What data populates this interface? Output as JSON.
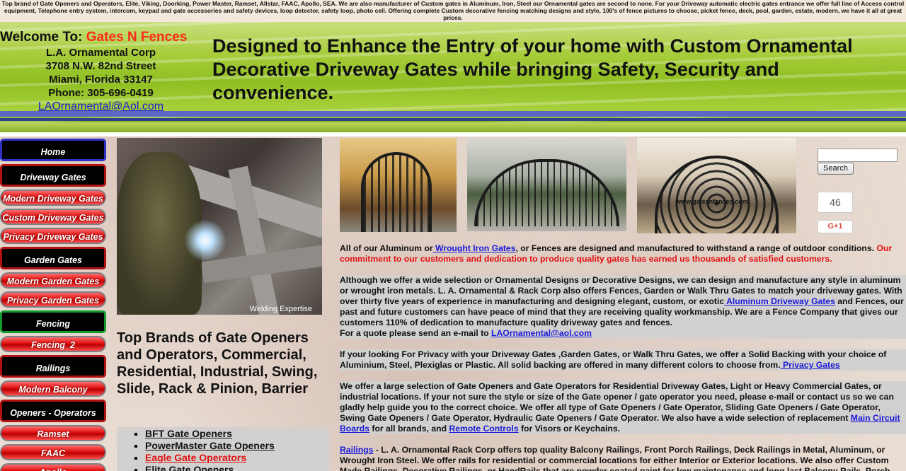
{
  "top_strip": {
    "text": "Top brand of Gate Openers and Operators, Elite, Viking, Doorking, Power Master, Ramset, Allstar, FAAC, Apollo, SEA. We are also manufacturer of Custom gates in Aluminum, Iron, Steel our Ornamental gates are second to none. For your Driveway automatic electric gates entrance we offer full line of Access control equipment, Telephone entry system, intercom, keypad and gate accessories and safety devices, loop detector, safety loop, photo cell. Offering complete Custom decorative fencing matching designs and style, 100's of fence pictures to choose, picket fence, deck, pool, garden, estate, modern, we have it all at great prices."
  },
  "header": {
    "welcome_prefix": "Welcome To: ",
    "welcome_brand": "Gates N Fences",
    "company": "L.A. Ornamental Corp",
    "street": "3708 N.W. 82nd Street",
    "city": "Miami, Florida 33147",
    "phone": "Phone: 305-696-0419",
    "email": "LAOrnamental@Aol.com",
    "tagline": "Designed to Enhance the Entry of your home with Custom Ornamental Decorative Driveway Gates while bringing Safety, Security and convenience."
  },
  "nav": {
    "items": [
      {
        "label": "Home"
      },
      {
        "label": "Driveway Gates"
      },
      {
        "label": "Modern Driveway Gates"
      },
      {
        "label": "Custom Driveway Gates"
      },
      {
        "label": "Privacy Driveway Gates"
      },
      {
        "label": "Garden Gates"
      },
      {
        "label": "Modern Garden Gates"
      },
      {
        "label": "Privacy Garden Gates"
      },
      {
        "label": "Fencing"
      },
      {
        "label": "Fencing_2"
      },
      {
        "label": "Railings"
      },
      {
        "label": "Modern Balcony Railings"
      },
      {
        "label": "Openers - Operators"
      },
      {
        "label": "Ramset"
      },
      {
        "label": "FAAC"
      },
      {
        "label": "Apollo"
      }
    ]
  },
  "welding_image": {
    "caption": "Welding Expertise"
  },
  "brands": {
    "title": "Top Brands of Gate Openers and Operators, Commercial, Residential, Industrial, Swing, Slide, Rack & Pinion, Barrier",
    "list": [
      "BFT Gate Openers",
      "PowerMaster Gate Openers",
      "Eagle Gate Operators",
      "Elite Gate Openers"
    ]
  },
  "gallery": {
    "watermark": "www.gatesnfences.com"
  },
  "sidebar_right": {
    "search_placeholder": "",
    "search_button": "Search",
    "share_count": "46",
    "gplus_label": "G+1"
  },
  "content": {
    "p1_a": "All of our Aluminum or",
    "p1_link": " Wrought Iron Gates",
    "p1_b": ", or Fences are designed and manufactured to withstand a range of outdoor conditions.",
    "p1_red": " Our commitment to our customers and dedication to produce quality gates has earned us thousands of satisfied customers.",
    "p2_a": "Although we offer a wide selection or Ornamental Designs or Decorative Designs, we can design and manufacture any style in aluminum or wrought iron metals. L. A. Ornamental & Rack Corp also offers Fences, Garden or Walk Thru Gates to match your driveway  gates. With over thirty five years of experience in manufacturing and designing elegant, custom, or exotic",
    "p2_link": " Aluminum Driveway Gates",
    "p2_b": " and Fences, our past and future customers can have peace of mind that they are receiving quality workmanship.  We are a Fence Company that gives our customers 110% of dedication to manufacture quality driveway gates and fences.",
    "p2_quote": "For a quote please send an e-mail to ",
    "p2_email": "LAOrnamental@aol.com",
    "p3_a": "If your looking For Privacy with your Driveway Gates ,Garden Gates, or Walk Thru Gates, we offer a Solid Backing with your choice of Aluminium, Steel, Plexiglas or Plastic.  All solid backing are offered in many different colors to choose from.",
    "p3_link": " Privacy Gates",
    "p4_a": "We offer a large selection of  Gate Openers and Gate Operators for Residential Driveway Gates, Light or Heavy Commercial Gates, or industrial locations. If your not sure the style or size of the Gate opener / gate operator  you need, please e-mail or contact us so we can gladly help guide you to the correct choice. We offer all type of Gate Openers / Gate Operator, Sliding Gate Openers / Gate Operator, Swing Gate Openers / Gate Operator, Hydraulic Gate Openers / Gate Operator. We also have a wide selection of replacement",
    "p4_link1": "Main Circuit Boards",
    "p4_b": " for all brands, and ",
    "p4_link2": "Remote Controls",
    "p4_c": "  for Visors or Keychains.",
    "p5_link": "Railings",
    "p5_a": " - L. A. Ornamental Rack Corp offers top quality Balcony Railings, Front Porch Railings, Deck Railings in Metal, Aluminum, or Wrought Iron Steel.  We offer rails for residential or commercial locations for either Interior or Exterior locations. We also offer Custom Made Railings, Decorative Railings, or HandRails that are powder coated paint for low maintenance and long last Balcony Rails, Porch Rails, or Deck Rails."
  },
  "colors": {
    "brand_red": "#ff2a1a",
    "link_blue": "#1a1ad8",
    "banner_green": "#9fc832"
  }
}
